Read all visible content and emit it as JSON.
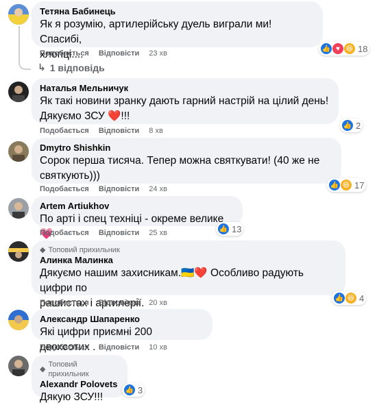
{
  "actions": {
    "like": "Подобається",
    "reply": "Відповісти"
  },
  "comments": [
    {
      "author": "Тетяна Бабинець",
      "text": "Як я розумію, артилерійську дуель виграли ми! Спасибі,\nхлопці....",
      "time": "23 хв",
      "reactions": [
        "like",
        "love",
        "haha"
      ],
      "count": "18",
      "badge": ""
    },
    {
      "author": "Наталья Мельничук",
      "text": "Як такі новини зранку дають гарний настрій на цілий день!\nДякуємо ЗСУ ❤️!!!",
      "time": "8 хв",
      "reactions": [
        "like"
      ],
      "count": "2",
      "badge": ""
    },
    {
      "author": "Dmytro Shishkin",
      "text": "Сорок перша тисяча. Тепер можна святкувати! (40 же не\nсвяткують)))",
      "time": "24 хв",
      "reactions": [
        "like",
        "haha"
      ],
      "count": "17",
      "badge": ""
    },
    {
      "author": "Artem Artiukhov",
      "text": "По арті і спец техніці - окреме велике 💗",
      "time": "25 хв",
      "reactions": [
        "like"
      ],
      "count": "13",
      "badge": ""
    },
    {
      "author": "Алинка Малинка",
      "text": "Дякуємо нашим захисникам.🇺🇦❤️  Особливо радують цифри по\nрашистах і артилерії.",
      "time": "20 хв",
      "reactions": [
        "like",
        "haha"
      ],
      "count": "4",
      "badge": "Топовий прихильник"
    },
    {
      "author": "Александр Шапаренко",
      "text": "Які цифри приємні 200 двохсотих .",
      "time": "10 хв",
      "reactions": [],
      "count": "",
      "badge": ""
    },
    {
      "author": "Alexandr Polovets",
      "text": "Дякую ЗСУ!!!",
      "time": "",
      "reactions": [
        "like"
      ],
      "count": "3",
      "badge": "Топовий прихильник"
    }
  ],
  "replies_link": "1 відповідь",
  "colors": {
    "bubble": "#f0f2f5",
    "meta": "#65676b",
    "like": "#1b74e4",
    "love": "#f33e58",
    "haha": "#f7b125"
  },
  "icons": {
    "badge": "diamond-icon",
    "reply_arrow": "reply-arrow-icon"
  }
}
